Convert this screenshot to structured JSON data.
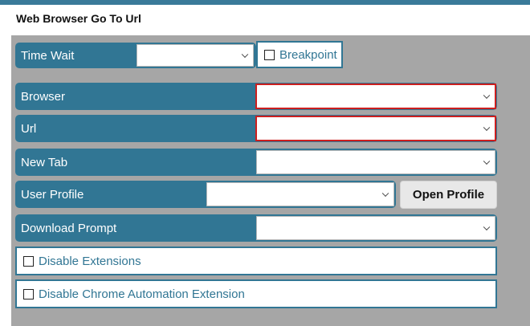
{
  "window": {
    "title": "Web Browser Go To Url"
  },
  "fields": {
    "time_wait": {
      "label": "Time Wait",
      "value": ""
    },
    "breakpoint": {
      "label": "Breakpoint",
      "checked": false
    },
    "browser": {
      "label": "Browser",
      "value": ""
    },
    "url": {
      "label": "Url",
      "value": ""
    },
    "new_tab": {
      "label": "New Tab",
      "value": ""
    },
    "user_profile": {
      "label": "User Profile",
      "value": ""
    },
    "download_prompt": {
      "label": "Download Prompt",
      "value": ""
    },
    "disable_extensions": {
      "label": "Disable Extensions",
      "checked": false
    },
    "disable_chrome_automation": {
      "label": "Disable Chrome Automation Extension",
      "checked": false
    }
  },
  "buttons": {
    "open_profile": "Open Profile"
  },
  "colors": {
    "accent": "#317694",
    "panel": "#a6a6a6",
    "invalid": "#cc1f1f",
    "topbar": "#3a7a99"
  },
  "icons": {
    "dropdown": "chevron-down-icon",
    "checkbox": "checkbox-icon"
  }
}
